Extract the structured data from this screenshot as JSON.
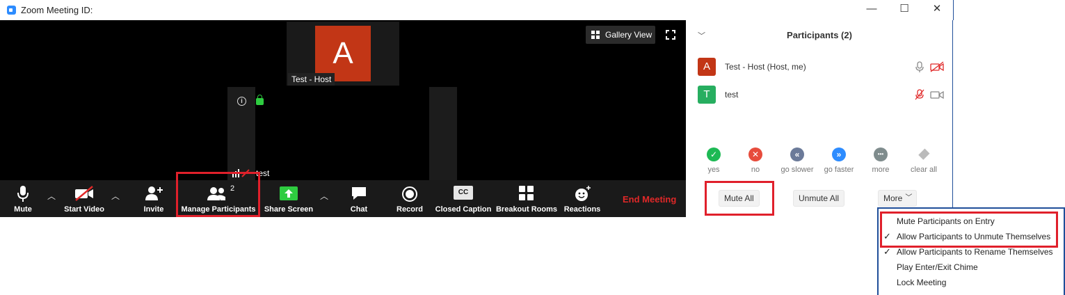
{
  "window": {
    "title": "Zoom Meeting ID:",
    "minimize": "—",
    "maximize": "☐",
    "close": "✕"
  },
  "video": {
    "host_initial": "A",
    "host_name": "Test - Host",
    "participant_label": "test",
    "gallery_view": "Gallery View"
  },
  "toolbar": {
    "mute": "Mute",
    "start_video": "Start Video",
    "invite": "Invite",
    "manage_participants": "Manage Participants",
    "participant_count": "2",
    "share_screen": "Share Screen",
    "chat": "Chat",
    "record": "Record",
    "closed_caption": "Closed Caption",
    "cc_glyph": "CC",
    "breakout_rooms": "Breakout Rooms",
    "reactions": "Reactions",
    "end_meeting": "End Meeting"
  },
  "panel": {
    "title": "Participants (2)",
    "participants": [
      {
        "initial": "A",
        "name": "Test - Host (Host, me)",
        "color": "#c23616"
      },
      {
        "initial": "T",
        "name": "test",
        "color": "#27ae60"
      }
    ],
    "reactions": [
      {
        "label": "yes",
        "glyph": "✓",
        "color": "#1db954"
      },
      {
        "label": "no",
        "glyph": "✕",
        "color": "#e74c3c"
      },
      {
        "label": "go slower",
        "glyph": "«",
        "color": "#6b7a99"
      },
      {
        "label": "go faster",
        "glyph": "»",
        "color": "#2d8cff"
      },
      {
        "label": "more",
        "glyph": "•••",
        "color": "#7f8c8d"
      },
      {
        "label": "clear all",
        "glyph": "",
        "color": "#bbbbbb"
      }
    ],
    "mute_all": "Mute All",
    "unmute_all": "Unmute All",
    "more": "More"
  },
  "menu": {
    "items": [
      {
        "label": "Mute Participants on Entry",
        "checked": false
      },
      {
        "label": "Allow Participants to Unmute Themselves",
        "checked": true
      },
      {
        "label": "Allow Participants to Rename Themselves",
        "checked": true
      },
      {
        "label": "Play Enter/Exit Chime",
        "checked": false
      },
      {
        "label": "Lock Meeting",
        "checked": false
      }
    ],
    "check_glyph": "✓"
  },
  "colors": {
    "highlight": "#e0202b",
    "accent_blue": "#2d8cff",
    "end_red": "#e02828",
    "share_green": "#2ecc40"
  }
}
